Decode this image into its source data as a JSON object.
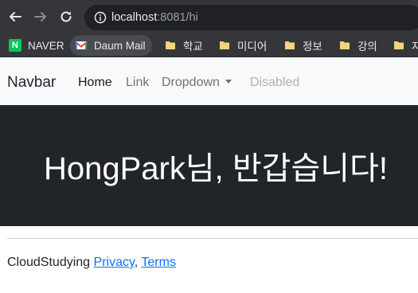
{
  "browser": {
    "url_host": "localhost",
    "url_rest": ":8081/hi",
    "bookmarks": [
      {
        "label": "NAVER",
        "icon": "naver-icon"
      },
      {
        "label": "Daum Mail",
        "icon": "gmail-icon"
      },
      {
        "label": "학교",
        "icon": "folder-icon"
      },
      {
        "label": "미디어",
        "icon": "folder-icon"
      },
      {
        "label": "정보",
        "icon": "folder-icon"
      },
      {
        "label": "강의",
        "icon": "folder-icon"
      },
      {
        "label": "자",
        "icon": "folder-icon"
      }
    ]
  },
  "navbar": {
    "brand": "Navbar",
    "links": {
      "home": "Home",
      "link": "Link",
      "dropdown": "Dropdown",
      "disabled": "Disabled"
    }
  },
  "hero": {
    "title": "HongPark님, 반갑습니다!"
  },
  "footer": {
    "text": "CloudStudying",
    "privacy": "Privacy",
    "separator": ",",
    "terms": "Terms"
  },
  "colors": {
    "browser_chrome": "#35363a",
    "address_bar": "#202124",
    "navbar_bg": "#f8f9fa",
    "hero_bg": "#212529",
    "link": "#0d6efd"
  }
}
